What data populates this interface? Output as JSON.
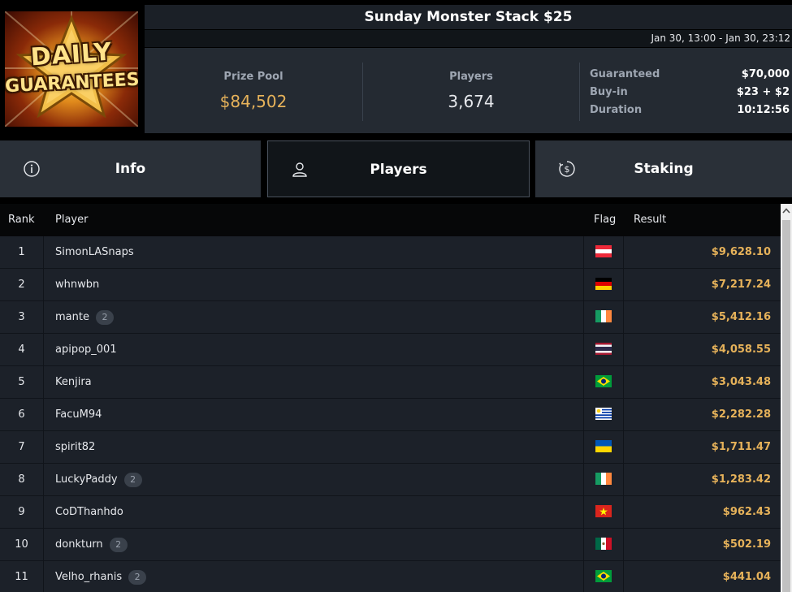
{
  "logo": {
    "line1": "DAILY",
    "line2": "GUARANTEES"
  },
  "tournament": {
    "title": "Sunday Monster Stack $25",
    "dates": "Jan 30, 13:00 - Jan 30, 23:12",
    "prize_pool_label": "Prize Pool",
    "prize_pool": "$84,502",
    "players_label": "Players",
    "players": "3,674",
    "guaranteed_label": "Guaranteed",
    "guaranteed": "$70,000",
    "buyin_label": "Buy-in",
    "buyin": "$23 + $2",
    "duration_label": "Duration",
    "duration": "10:12:56"
  },
  "tabs": [
    {
      "label": "Info",
      "icon": "info-icon",
      "active": false
    },
    {
      "label": "Players",
      "icon": "user-icon",
      "active": true
    },
    {
      "label": "Staking",
      "icon": "dollar-coin-icon",
      "active": false
    }
  ],
  "table": {
    "headers": {
      "rank": "Rank",
      "player": "Player",
      "flag": "Flag",
      "result": "Result"
    },
    "rows": [
      {
        "rank": "1",
        "player": "SimonLASnaps",
        "badge": "",
        "flag": "austria",
        "result": "$9,628.10"
      },
      {
        "rank": "2",
        "player": "whnwbn",
        "badge": "",
        "flag": "germany",
        "result": "$7,217.24"
      },
      {
        "rank": "3",
        "player": "mante",
        "badge": "2",
        "flag": "ireland",
        "result": "$5,412.16"
      },
      {
        "rank": "4",
        "player": "apipop_001",
        "badge": "",
        "flag": "thailand",
        "result": "$4,058.55"
      },
      {
        "rank": "5",
        "player": "Kenjira",
        "badge": "",
        "flag": "brazil",
        "result": "$3,043.48"
      },
      {
        "rank": "6",
        "player": "FacuM94",
        "badge": "",
        "flag": "uruguay",
        "result": "$2,282.28"
      },
      {
        "rank": "7",
        "player": "spirit82",
        "badge": "",
        "flag": "ukraine",
        "result": "$1,711.47"
      },
      {
        "rank": "8",
        "player": "LuckyPaddy",
        "badge": "2",
        "flag": "ireland",
        "result": "$1,283.42"
      },
      {
        "rank": "9",
        "player": "CoDThanhdo",
        "badge": "",
        "flag": "vietnam",
        "result": "$962.43"
      },
      {
        "rank": "10",
        "player": "donkturn",
        "badge": "2",
        "flag": "mexico",
        "result": "$502.19"
      },
      {
        "rank": "11",
        "player": "Velho_rhanis",
        "badge": "2",
        "flag": "brazil",
        "result": "$441.04"
      }
    ]
  },
  "colors": {
    "gold": "#e6b25a",
    "row_bg": "#1c2129",
    "header_bg": "#242a32"
  }
}
